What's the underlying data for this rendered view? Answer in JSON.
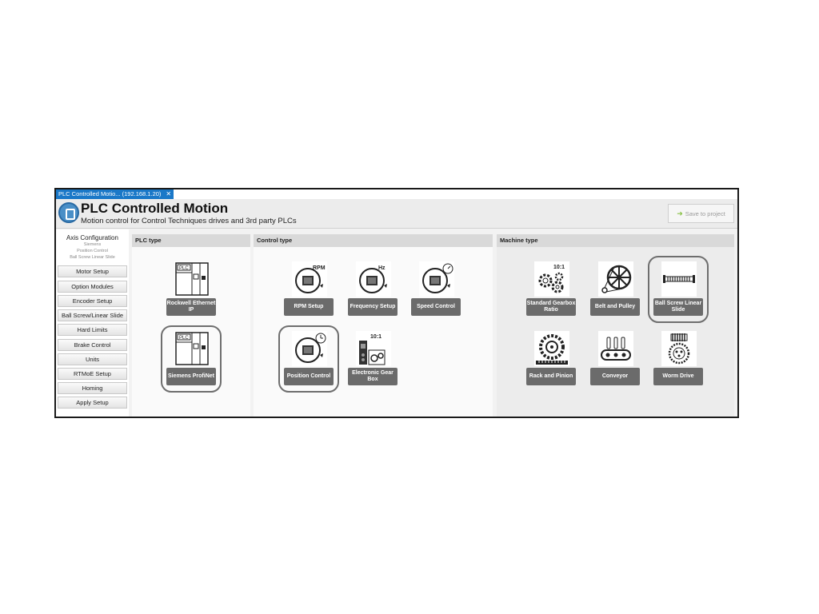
{
  "tab": {
    "label": "PLC Controlled Motio... (192.168.1.20)",
    "close": "✕"
  },
  "header": {
    "title": "PLC Controlled Motion",
    "subtitle": "Motion control for Control Techniques drives and 3rd party PLCs",
    "save_label": "Save to project"
  },
  "sidebar": {
    "title": "Axis Configuration",
    "lines": [
      "Siemens",
      "Position Control",
      "Ball Screw Linear Slide"
    ],
    "items": [
      {
        "label": "Motor Setup"
      },
      {
        "label": "Option Modules"
      },
      {
        "label": "Encoder Setup"
      },
      {
        "label": "Ball Screw/Linear Slide"
      },
      {
        "label": "Hard Limits"
      },
      {
        "label": "Brake Control"
      },
      {
        "label": "Units"
      },
      {
        "label": "RTMoE Setup"
      },
      {
        "label": "Homing"
      },
      {
        "label": "Apply Setup"
      }
    ]
  },
  "plc": {
    "heading": "PLC type",
    "items": [
      {
        "label": "Rockwell Ethernet IP",
        "icon": "plc-rack-icon"
      },
      {
        "label": "Siemens ProfiNet",
        "icon": "plc-rack-icon",
        "selected": true
      }
    ]
  },
  "control": {
    "heading": "Control type",
    "items": [
      {
        "label": "RPM Setup",
        "icon": "motor-rpm-icon",
        "badge": "RPM"
      },
      {
        "label": "Frequency Setup",
        "icon": "motor-hz-icon",
        "badge": "Hz"
      },
      {
        "label": "Speed Control",
        "icon": "motor-speed-icon"
      },
      {
        "label": "Position Control",
        "icon": "motor-position-icon",
        "selected": true
      },
      {
        "label": "Electronic Gear Box",
        "icon": "gearbox-icon",
        "badge": "10:1"
      }
    ]
  },
  "machine": {
    "heading": "Machine type",
    "items": [
      {
        "label": "Standard Gearbox Ratio",
        "icon": "gears-icon",
        "badge": "10:1"
      },
      {
        "label": "Belt and Pulley",
        "icon": "pulley-icon"
      },
      {
        "label": "Ball Screw Linear Slide",
        "icon": "ball-screw-icon",
        "selected": true
      },
      {
        "label": "Rack and Pinion",
        "icon": "rack-pinion-icon"
      },
      {
        "label": "Conveyor",
        "icon": "conveyor-icon"
      },
      {
        "label": "Worm Drive",
        "icon": "worm-drive-icon"
      }
    ]
  }
}
